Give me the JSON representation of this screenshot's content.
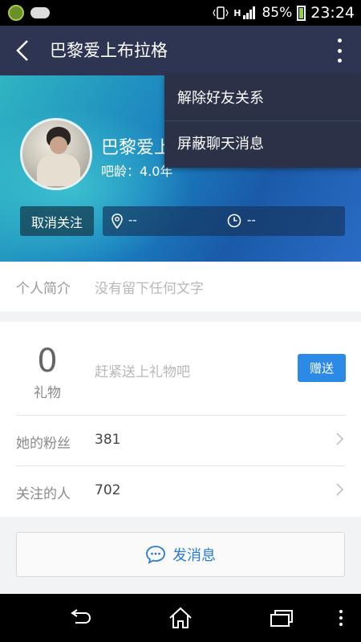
{
  "status_bar": {
    "battery": "85%",
    "time": "23:24",
    "network": "H"
  },
  "header": {
    "title": "巴黎爱上布拉格"
  },
  "menu": {
    "items": [
      "解除好友关系",
      "屏蔽聊天消息"
    ]
  },
  "profile": {
    "name": "巴黎爱上布拉格",
    "age": "吧龄：4.0年",
    "unfollow_label": "取消关注",
    "location": "--",
    "time": "--"
  },
  "intro": {
    "label": "个人简介",
    "value": "没有留下任何文字"
  },
  "gifts": {
    "count": "0",
    "label": "礼物",
    "hint": "赶紧送上礼物吧",
    "button": "赠送"
  },
  "stats": {
    "fans_label": "她的粉丝",
    "fans_value": "381",
    "following_label": "关注的人",
    "following_value": "702"
  },
  "actions": {
    "message_label": "发消息"
  },
  "colors": {
    "header_bg": "#2e3552",
    "accent_blue": "#2a8ae6",
    "message_text": "#2a7bd6"
  }
}
